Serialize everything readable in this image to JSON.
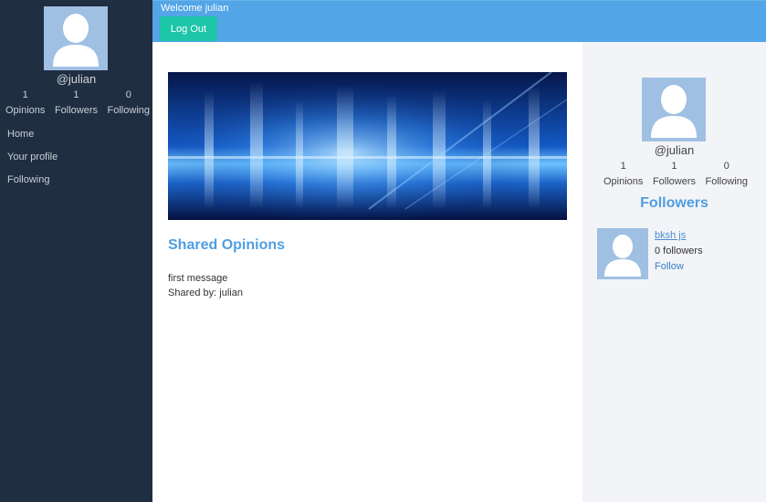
{
  "sidebar": {
    "handle": "@julian",
    "stats": [
      {
        "value": "1",
        "label": "Opinions"
      },
      {
        "value": "1",
        "label": "Followers"
      },
      {
        "value": "0",
        "label": "Following"
      }
    ],
    "nav": [
      "Home",
      "Your profile",
      "Following"
    ]
  },
  "header": {
    "welcome": "Welcome julian",
    "logout_label": "Log Out"
  },
  "main": {
    "section_title": "Shared Opinions",
    "opinions": [
      {
        "text": "first message",
        "shared_by": "Shared by: julian"
      }
    ]
  },
  "right_panel": {
    "handle": "@julian",
    "stats": [
      {
        "value": "1",
        "label": "Opinions"
      },
      {
        "value": "1",
        "label": "Followers"
      },
      {
        "value": "0",
        "label": "Following"
      }
    ],
    "followers_title": "Followers",
    "followers": [
      {
        "name": "bksh js",
        "count": "0 followers",
        "follow_label": "Follow"
      }
    ]
  },
  "colors": {
    "sidebar_bg": "#202e41",
    "header_bg": "#52a5e6",
    "logout_bg": "#1dc6a9",
    "accent": "#4f9ee0",
    "avatar_bg": "#9fc0e2"
  }
}
